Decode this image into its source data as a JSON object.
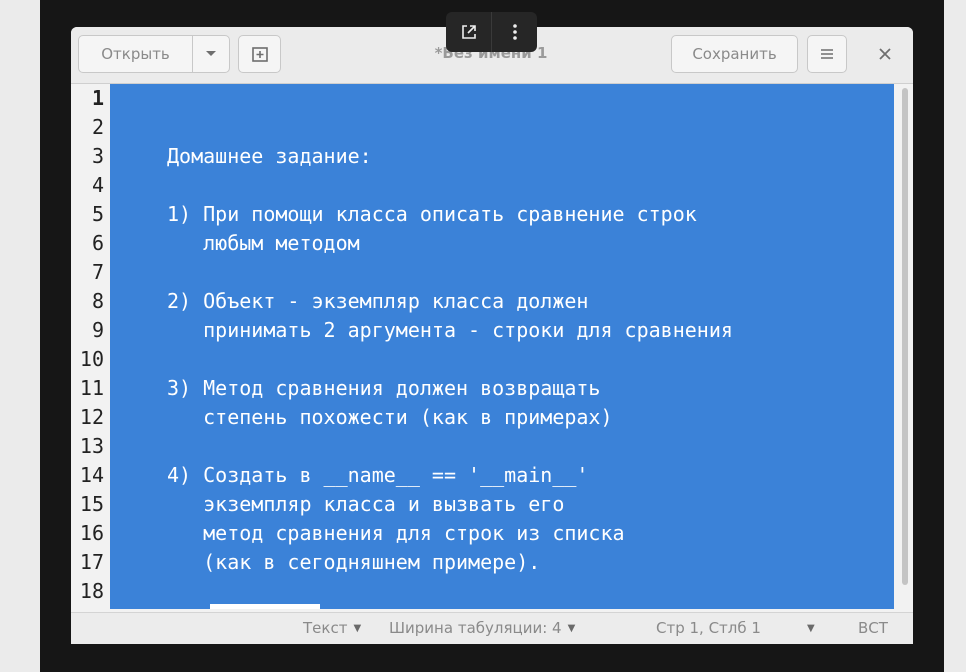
{
  "toolbar": {
    "open_label": "Открыть",
    "save_label": "Сохранить",
    "title": "*Без имени 1"
  },
  "editor": {
    "line_numbers": [
      "1",
      "2",
      "3",
      "4",
      "5",
      "6",
      "7",
      "8",
      "9",
      "10",
      "11",
      "12",
      "13",
      "14",
      "15",
      "16",
      "17",
      "18"
    ],
    "lines": [
      "",
      "",
      "Домашнее задание:",
      "",
      "1) При помощи класса описать сравнение строк",
      "   любым методом",
      "",
      "2) Объект - экземпляр класса должен",
      "   принимать 2 аргумента - строки для сравнения",
      "",
      "3) Метод сравнения должен возвращать",
      "   степень похожести (как в примерах)",
      "",
      "4) Создать в __name__ == '__main__'",
      "   экземпляр класса и вызвать его",
      "   метод сравнения для строк из списка",
      "   (как в сегодняшнем примере).",
      ""
    ]
  },
  "statusbar": {
    "syntax": "Текст",
    "tab_width": "Ширина табуляции: 4",
    "position": "Стр 1, Стлб 1",
    "insert_mode": "ВСТ"
  },
  "colors": {
    "selection": "#3b82d8",
    "overlay": "#262626"
  },
  "icons": [
    "chevron-down-icon",
    "new-tab-icon",
    "hamburger-menu-icon",
    "close-icon",
    "open-external-icon",
    "more-vertical-icon"
  ]
}
